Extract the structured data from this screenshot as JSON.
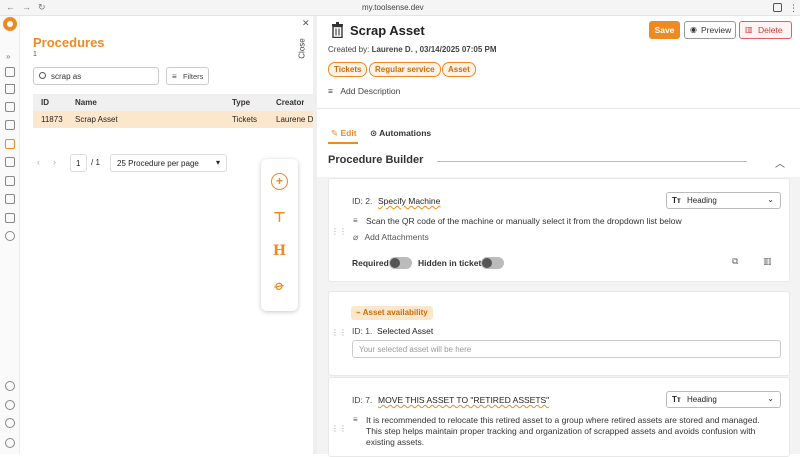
{
  "browser": {
    "url": "my.toolsense.dev",
    "back": "←",
    "forward": "→",
    "reload": "↻"
  },
  "left": {
    "title": "Procedures",
    "count": "1",
    "search_value": "scrap as",
    "filters_label": "Filters",
    "table": {
      "columns": [
        "ID",
        "Name",
        "Type",
        "Creator"
      ],
      "rows": [
        {
          "id": "11873",
          "name": "Scrap Asset",
          "type": "Tickets",
          "creator": "Laurene D."
        }
      ]
    },
    "pager": {
      "page": "1",
      "total": "/ 1",
      "per_page": "25 Procedure per page"
    }
  },
  "close_label": "Close",
  "close_symbol": "✕",
  "right": {
    "title": "Scrap Asset",
    "save": "Save",
    "preview": "Preview",
    "delete": "Delete",
    "created_prefix": "Created by: ",
    "created_by": "Laurene D. , 03/14/2025 07:05 PM",
    "tags": [
      "Tickets",
      "Regular service",
      "Asset"
    ],
    "add_description": "Add Description",
    "tabs": {
      "edit": "Edit",
      "automations": "Automations"
    },
    "builder_title": "Procedure Builder",
    "q1": {
      "id": "ID: 2.",
      "title": "Specify Machine",
      "type": "Heading",
      "type_icon": "Tт",
      "description": "Scan the QR code of the machine or manually select it from the dropdown list below",
      "add_attachments": "Add Attachments",
      "required": "Required",
      "hidden": "Hidden in ticket"
    },
    "q2": {
      "badge": "Asset availability",
      "id": "ID: 1.",
      "title": "Selected Asset",
      "placeholder": "Your selected asset will be here"
    },
    "q3": {
      "id": "ID: 7.",
      "title": "MOVE THIS ASSET TO \"RETIRED ASSETS\"",
      "type": "Heading",
      "type_icon": "Tт",
      "description": "It is recommended to relocate this retired asset to a group where retired assets are stored and managed. This step helps maintain proper tracking and organization of scrapped assets and avoids confusion with existing assets."
    }
  },
  "colors": {
    "accent": "#ef8a1f",
    "danger": "#d23a3a",
    "highlight": "#fde7cc"
  }
}
